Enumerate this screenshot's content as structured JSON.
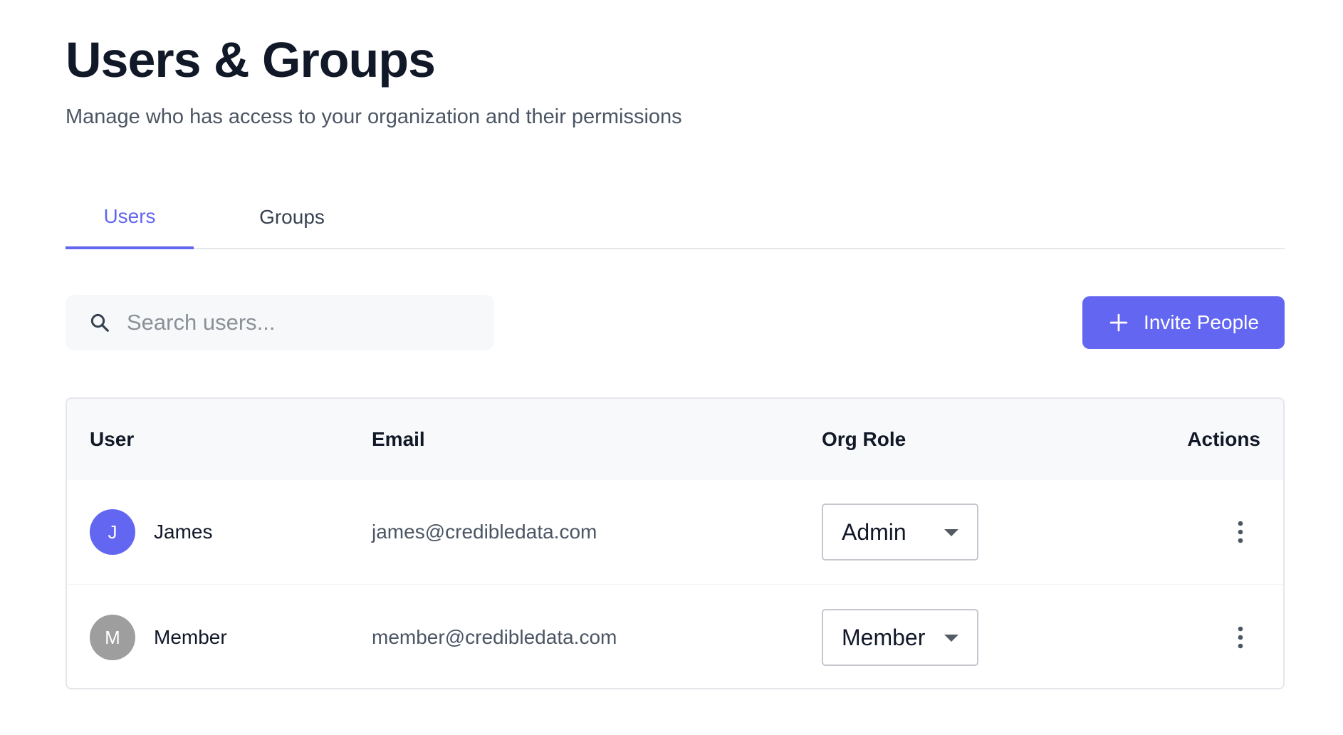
{
  "header": {
    "title": "Users & Groups",
    "subtitle": "Manage who has access to your organization and their permissions"
  },
  "tabs": [
    {
      "label": "Users",
      "active": true
    },
    {
      "label": "Groups",
      "active": false
    }
  ],
  "search": {
    "placeholder": "Search users...",
    "value": "",
    "icon": "search-icon"
  },
  "invite_button": {
    "label": "Invite People",
    "icon": "plus-icon"
  },
  "table": {
    "columns": [
      "User",
      "Email",
      "Org Role",
      "Actions"
    ],
    "rows": [
      {
        "initial": "J",
        "name": "James",
        "email": "james@credibledata.com",
        "role": "Admin",
        "avatar_color": "#6366f1",
        "actions_icon": "more-vertical-icon"
      },
      {
        "initial": "M",
        "name": "Member",
        "email": "member@credibledata.com",
        "role": "Member",
        "avatar_color": "#9e9e9e",
        "actions_icon": "more-vertical-icon"
      }
    ]
  },
  "colors": {
    "accent": "#6366f1",
    "text_primary": "#111827",
    "text_secondary": "#4b5563"
  }
}
